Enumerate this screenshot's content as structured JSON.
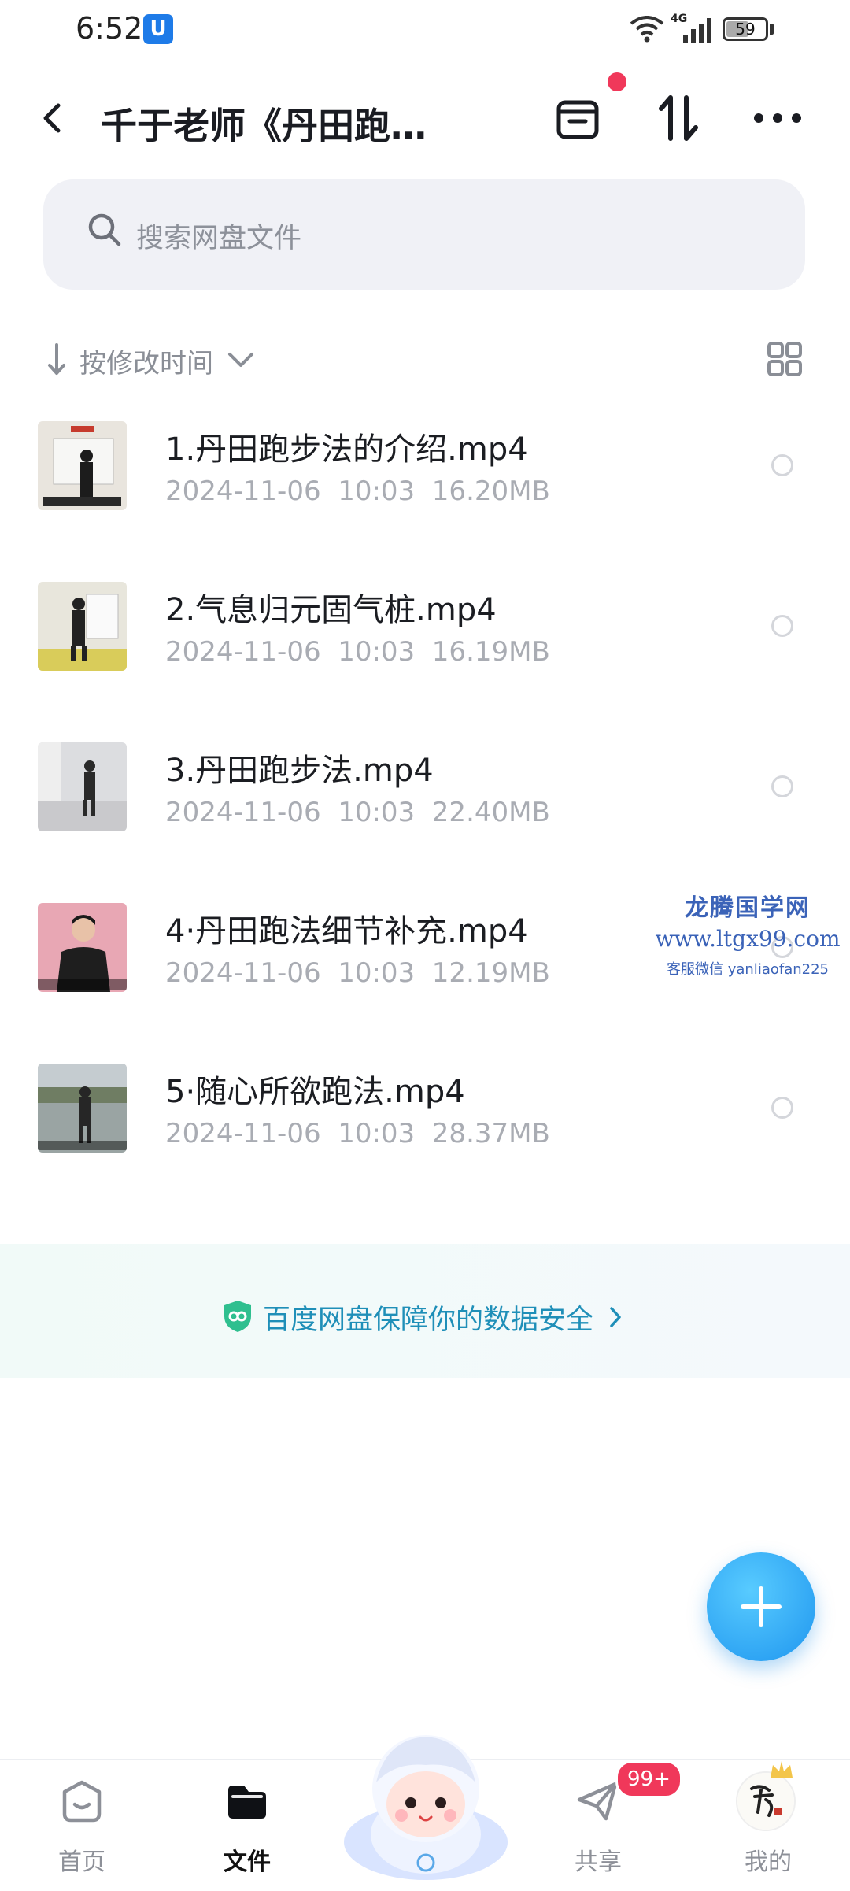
{
  "status_bar": {
    "time": "6:52",
    "app_icon_glyph": "U",
    "network": "4G",
    "battery": "59",
    "battery_level": 0.59
  },
  "header": {
    "title": "千于老师《丹田跑…"
  },
  "search": {
    "placeholder": "搜索网盘文件"
  },
  "sort": {
    "label": "按修改时间"
  },
  "files": [
    {
      "name": "1.丹田跑步法的介绍.mp4",
      "meta": "2024-11-06  10:03  16.20MB",
      "thumb_bg": "#e9e5de",
      "figure": "#1c1c1c"
    },
    {
      "name": "2.气息归元固气桩.mp4",
      "meta": "2024-11-06  10:03  16.19MB",
      "thumb_bg": "#e8e6dc",
      "figure": "#222222"
    },
    {
      "name": "3.丹田跑步法.mp4",
      "meta": "2024-11-06  10:03  22.40MB",
      "thumb_bg": "#dcdde0",
      "figure": "#2a2a2a"
    },
    {
      "name": "4·丹田跑法细节补充.mp4",
      "meta": "2024-11-06  10:03  12.19MB",
      "thumb_bg": "#e8a7b4",
      "figure": "#1e1e1e"
    },
    {
      "name": "5·随心所欲跑法.mp4",
      "meta": "2024-11-06  10:03  28.37MB",
      "thumb_bg": "#9aa4a3",
      "figure": "#262626"
    }
  ],
  "watermark": {
    "title": "龙腾国学网",
    "url": "www.ltgx99.com",
    "contact": "客服微信 yanliaofan225"
  },
  "security_banner": {
    "text": "百度网盘保障你的数据安全"
  },
  "bottom_nav": {
    "items": [
      {
        "label": "首页",
        "icon": "home-icon"
      },
      {
        "label": "文件",
        "icon": "folder-icon",
        "active": true
      },
      {
        "label": "共享",
        "icon": "share-icon",
        "badge": "99+"
      },
      {
        "label": "我的",
        "icon": "avatar"
      }
    ]
  },
  "colors": {
    "accent": "#1f96ef",
    "badge": "#f0385a",
    "security_text": "#1f8fb8"
  }
}
